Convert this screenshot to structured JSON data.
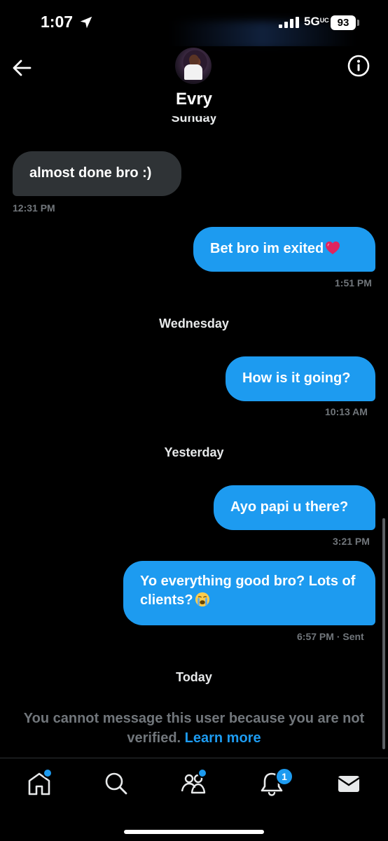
{
  "status": {
    "time": "1:07",
    "network": "5G",
    "network_sub": "UC",
    "battery": "93"
  },
  "header": {
    "title": "Evry"
  },
  "days": {
    "partial": "Sunday",
    "wednesday": "Wednesday",
    "yesterday": "Yesterday",
    "today": "Today"
  },
  "messages": [
    {
      "text": "almost done bro :)",
      "time": "12:31 PM",
      "direction": "received"
    },
    {
      "text": "Bet bro im exited",
      "emoji": "red-heart",
      "time": "1:51 PM",
      "direction": "sent"
    },
    {
      "text": "How is it going?",
      "time": "10:13 AM",
      "direction": "sent"
    },
    {
      "text": "Ayo papi u there?",
      "time": "3:21 PM",
      "direction": "sent"
    },
    {
      "text": "Yo everything good bro? Lots of clients?",
      "emoji": "loudly-crying-face",
      "time": "6:57 PM",
      "status": "· Sent",
      "direction": "sent"
    }
  ],
  "notice": {
    "text": "You cannot message this user because you are not verified. ",
    "link": "Learn more"
  },
  "tabs": [
    {
      "name": "home",
      "dot": true
    },
    {
      "name": "search"
    },
    {
      "name": "communities",
      "dot": true
    },
    {
      "name": "notifications",
      "badge": "1"
    },
    {
      "name": "messages"
    }
  ],
  "colors": {
    "accent": "#1d9bf0",
    "received_bubble": "#2f3336",
    "muted": "#71767b"
  }
}
